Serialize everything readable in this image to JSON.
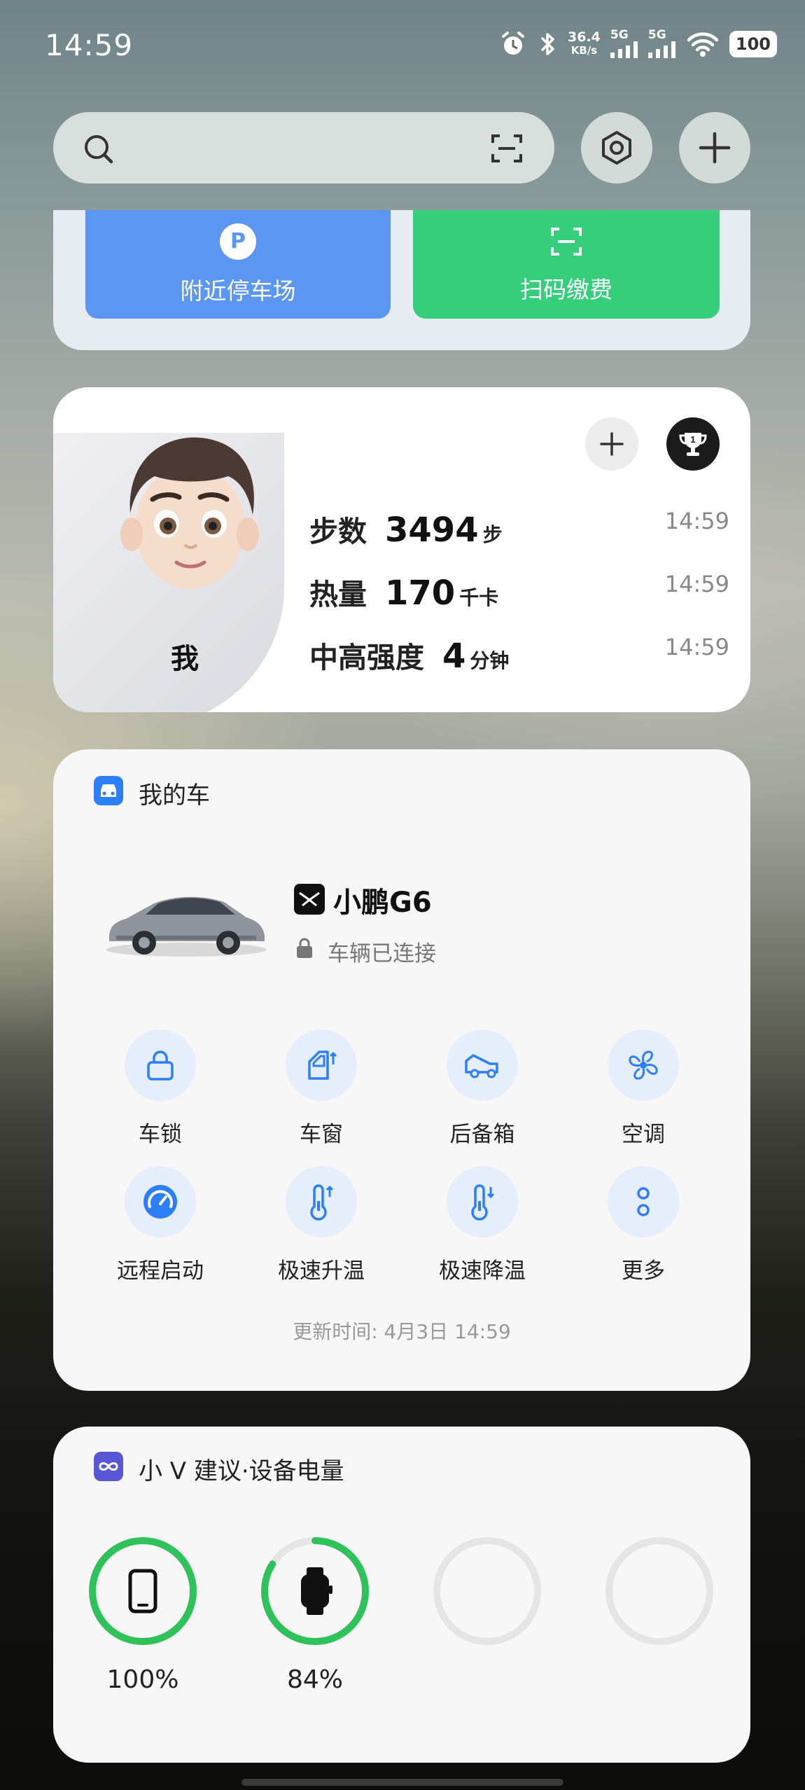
{
  "status_bar": {
    "time": "14:59",
    "net_speed_value": "36.4",
    "net_speed_unit": "KB/s",
    "sim1": "5G",
    "sim2": "5G",
    "battery": "100"
  },
  "quick_tiles": [
    {
      "label": "附近停车场",
      "icon": "parking-icon",
      "color": "#5b96f3"
    },
    {
      "label": "扫码缴费",
      "icon": "scan-icon",
      "color": "#35cf7c"
    }
  ],
  "health": {
    "name": "我",
    "metrics": [
      {
        "label": "步数",
        "value": "3494",
        "unit": "步",
        "time": "14:59"
      },
      {
        "label": "热量",
        "value": "170",
        "unit": "千卡",
        "time": "14:59"
      },
      {
        "label": "中高强度",
        "value": "4",
        "unit": "分钟",
        "time": "14:59"
      }
    ]
  },
  "car_card": {
    "title": "我的车",
    "model": "小鹏G6",
    "status": "车辆已连接",
    "controls": [
      {
        "label": "车锁",
        "icon": "lock-icon"
      },
      {
        "label": "车窗",
        "icon": "window-icon"
      },
      {
        "label": "后备箱",
        "icon": "trunk-icon"
      },
      {
        "label": "空调",
        "icon": "fan-icon"
      },
      {
        "label": "远程启动",
        "icon": "speedometer-icon"
      },
      {
        "label": "极速升温",
        "icon": "thermometer-up-icon"
      },
      {
        "label": "极速降温",
        "icon": "thermometer-down-icon"
      },
      {
        "label": "更多",
        "icon": "more-icon"
      }
    ],
    "updated": "更新时间: 4月3日 14:59"
  },
  "battery_card": {
    "title": "小 V 建议·设备电量",
    "devices": [
      {
        "icon": "phone-icon",
        "level": 100,
        "label": "100%"
      },
      {
        "icon": "watch-icon",
        "level": 84,
        "label": "84%"
      },
      {
        "icon": "",
        "level": 0,
        "label": ""
      },
      {
        "icon": "",
        "level": 0,
        "label": ""
      }
    ],
    "ring_color": "#2fc25b"
  }
}
